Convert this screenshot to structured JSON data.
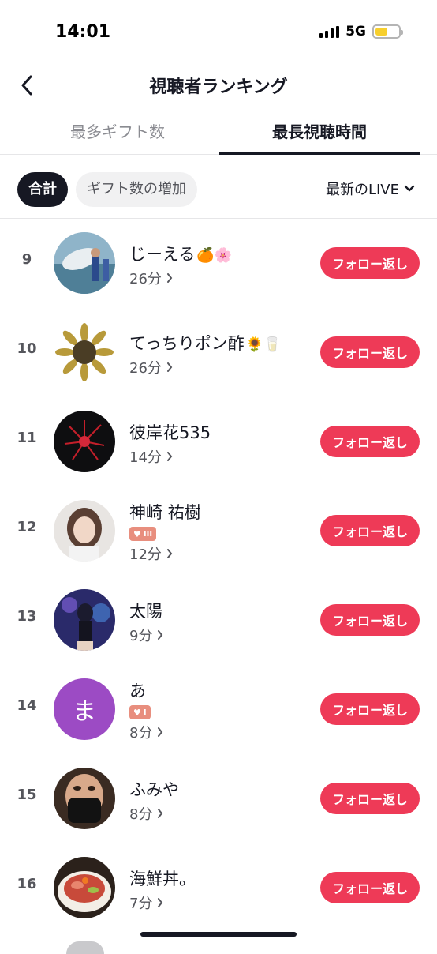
{
  "status": {
    "time": "14:01",
    "network": "5G"
  },
  "header": {
    "title": "視聴者ランキング"
  },
  "tabs": [
    {
      "label": "最多ギフト数",
      "active": false
    },
    {
      "label": "最長視聴時間",
      "active": true
    }
  ],
  "filters": {
    "total": "合計",
    "gift_increase": "ギフト数の増加",
    "sort": "最新のLIVE"
  },
  "colors": {
    "follow_button": "#ee3a57",
    "chip_selected": "#161823",
    "badge": "#e88e7e"
  },
  "viewers": [
    {
      "rank": "9",
      "name": "じーえる",
      "emoji": "🍊🌸",
      "duration": "26分",
      "badge": "",
      "action": "フォロー返し",
      "avatar": "photo-whale"
    },
    {
      "rank": "10",
      "name": "てっちりポン酢",
      "emoji": "🌻🥛",
      "duration": "26分",
      "badge": "",
      "action": "フォロー返し",
      "avatar": "photo-sunflower"
    },
    {
      "rank": "11",
      "name": "彼岸花535",
      "emoji": "",
      "duration": "14分",
      "badge": "",
      "action": "フォロー返し",
      "avatar": "photo-red-flower"
    },
    {
      "rank": "12",
      "name": "神崎 祐樹",
      "emoji": "",
      "duration": "12分",
      "badge": "III",
      "action": "フォロー返し",
      "avatar": "photo-person"
    },
    {
      "rank": "13",
      "name": "太陽",
      "emoji": "",
      "duration": "9分",
      "badge": "",
      "action": "フォロー返し",
      "avatar": "photo-anime"
    },
    {
      "rank": "14",
      "name": "あ",
      "emoji": "",
      "duration": "8分",
      "badge": "I",
      "action": "フォロー返し",
      "avatar_letter": "ま"
    },
    {
      "rank": "15",
      "name": "ふみや",
      "emoji": "",
      "duration": "8分",
      "badge": "",
      "action": "フォロー返し",
      "avatar": "photo-mask"
    },
    {
      "rank": "16",
      "name": "海鮮丼。",
      "emoji": "",
      "duration": "7分",
      "badge": "",
      "action": "フォロー返し",
      "avatar": "photo-food"
    }
  ]
}
